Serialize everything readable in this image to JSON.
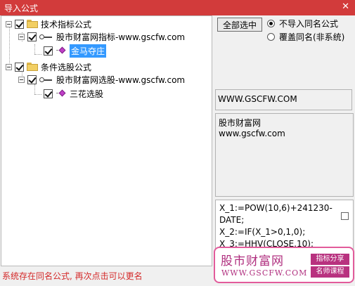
{
  "window": {
    "title": "导入公式",
    "close_glyph": "✕"
  },
  "tree": {
    "items": [
      {
        "label": "技术指标公式",
        "level": 0,
        "icon": "folder-icon",
        "checked": true,
        "expanded": true
      },
      {
        "label": "股市财富网指标-www.gscfw.com",
        "level": 1,
        "icon": "key-icon",
        "checked": true,
        "expanded": true
      },
      {
        "label": "金马夺庄",
        "level": 2,
        "icon": "gem-icon",
        "checked": true,
        "selected": true
      },
      {
        "label": "条件选股公式",
        "level": 0,
        "icon": "folder-icon",
        "checked": true,
        "expanded": true
      },
      {
        "label": "股市财富网选股-www.gscfw.com",
        "level": 1,
        "icon": "key-icon",
        "checked": true,
        "expanded": true
      },
      {
        "label": "三花选股",
        "level": 2,
        "icon": "gem-icon",
        "checked": true,
        "selected": false
      }
    ]
  },
  "controls": {
    "select_all_label": "全部选中",
    "radio_options": [
      {
        "label": "不导入同名公式",
        "selected": true
      },
      {
        "label": "覆盖同名(非系统)",
        "selected": false
      }
    ]
  },
  "info": {
    "url": "WWW.GSCFW.COM",
    "desc_lines": [
      "股市财富网",
      "www.gscfw.com"
    ]
  },
  "code": {
    "lines": [
      "X_1:=POW(10,6)+241230-",
      "DATE;",
      "X_2:=IF(X_1>0,1,0);",
      "X_3:=HHV(CLOSE,10);"
    ]
  },
  "status": {
    "text": "系统存在同名公式, 再次点击可以更名",
    "color": "#d42a2a"
  },
  "watermark": {
    "name": "股市财富网",
    "url": "WWW.GSCFW.COM",
    "badge1": "指标分享",
    "badge2": "名师课程"
  },
  "colors": {
    "titlebar": "#d23b3b",
    "selection": "#3399ff",
    "brand": "#b8327f"
  }
}
